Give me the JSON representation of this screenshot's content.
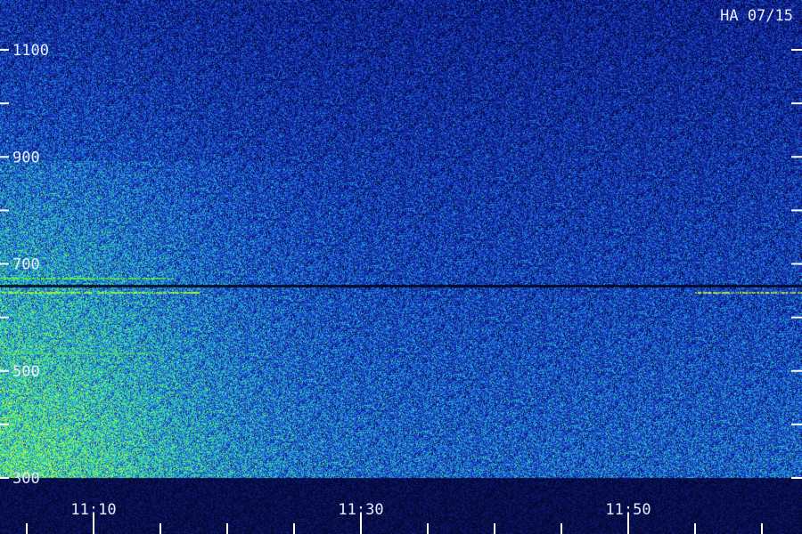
{
  "chart_data": {
    "type": "heatmap",
    "title": "HA 07/15",
    "xlabel": "",
    "ylabel": "",
    "x_axis": {
      "unit": "time",
      "range_minutes": [
        "11:03",
        "11:63"
      ],
      "major_ticks": [
        "11:10",
        "11:30",
        "11:50"
      ]
    },
    "y_axis": {
      "range": [
        300,
        1150
      ],
      "labeled_ticks": [
        1100,
        900,
        700,
        500,
        300
      ],
      "minor_ticks": [
        1000,
        800,
        600,
        400
      ]
    },
    "colormap": [
      "#000428",
      "#0a1a8a",
      "#1e3cd2",
      "#1eb4dc",
      "#64ff64",
      "#ffff00"
    ],
    "features": [
      {
        "kind": "narrow-band line",
        "y": 675,
        "x_range": [
          "11:03",
          "11:16"
        ],
        "color": "#64ff32"
      },
      {
        "kind": "narrow-band line",
        "y": 648,
        "x_range": [
          "11:03",
          "11:18"
        ],
        "color": "#b4ff32"
      },
      {
        "kind": "narrow-band line",
        "y": 648,
        "x_range": [
          "11:55",
          "11:63"
        ],
        "color": "#e6ff32"
      },
      {
        "kind": "narrow-band line",
        "y": 534,
        "x_range": [
          "11:03",
          "11:15"
        ],
        "color": "#50dc64"
      },
      {
        "kind": "diffuse enhancement",
        "y_range": [
          300,
          900
        ],
        "x_range": [
          "11:03",
          "11:18"
        ]
      }
    ]
  }
}
